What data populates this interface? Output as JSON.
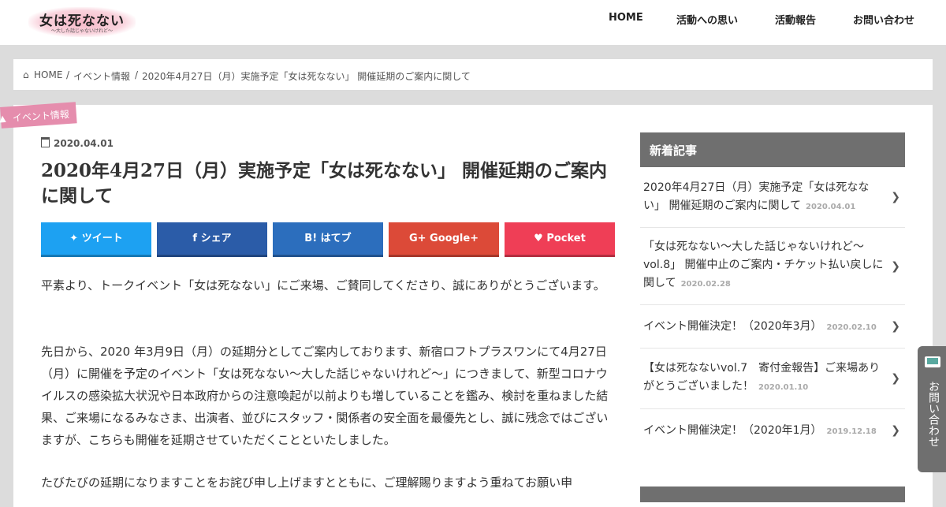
{
  "header": {
    "logo_main": "女は死なない",
    "logo_sub": "〜大した話じゃないけれど〜",
    "nav": [
      "HOME",
      "活動への思い",
      "活動報告",
      "お問い合わせ"
    ]
  },
  "breadcrumb": {
    "home": "HOME",
    "sep": "/",
    "category": "イベント情報",
    "current": "2020年4月27日（月）実施予定「女は死なない」 開催延期のご案内に関して"
  },
  "article": {
    "category": "イベント情報",
    "date": "2020.04.01",
    "title": "2020年4月27日（月）実施予定「女は死なない」 開催延期のご案内に関して",
    "share": [
      {
        "icon": "🐦",
        "label": "ツイート",
        "color": "#1da1f2"
      },
      {
        "icon": "f",
        "label": "シェア",
        "color": "#2b5ca8"
      },
      {
        "icon": "B!",
        "label": "はてブ",
        "color": "#2c6ebd"
      },
      {
        "icon": "G+",
        "label": "Google+",
        "color": "#dc4a38"
      },
      {
        "icon": "♥",
        "label": "Pocket",
        "color": "#ef3e56"
      }
    ],
    "paragraphs": [
      "平素より、トークイベント「女は死なない」にご来場、ご賛同してくださり、誠にありがとうございます。",
      "先日から、2020 年3月9日（月）の延期分としてご案内しております、新宿ロフトプラスワンにて4月27日（月）に開催を予定のイベント「女は死なない〜大した話じゃないけれど〜」につきまして、新型コロナウイルスの感染拡大状況や日本政府からの注意喚起が以前よりも増していることを鑑み、検討を重ねました結果、ご来場になるみなさま、出演者、並びにスタッフ・関係者の安全面を最優先とし、誠に残念ではございますが、こちらも開催を延期させていただくことといたしました。",
      "たびたびの延期になりますことをお詫び申し上げますとともに、ご理解賜りますよう重ねてお願い申"
    ]
  },
  "sidebar": {
    "heading": "新着記事",
    "items": [
      {
        "title": "2020年4月27日（月）実施予定「女は死なない」 開催延期のご案内に関して",
        "date": "2020.04.01"
      },
      {
        "title": "「女は死なない〜大した話じゃないけれど〜vol.8」 開催中止のご案内・チケット払い戻しに関して",
        "date": "2020.02.28"
      },
      {
        "title": "イベント開催決定！（2020年3月）",
        "date": "2020.02.10"
      },
      {
        "title": "【女は死なないvol.7　寄付金報告】ご来場ありがとうございました！",
        "date": "2020.01.10"
      },
      {
        "title": "イベント開催決定！（2020年1月）",
        "date": "2019.12.18"
      }
    ],
    "chevron": "❯"
  },
  "contact_tab": {
    "label": "お問い合わせ"
  }
}
